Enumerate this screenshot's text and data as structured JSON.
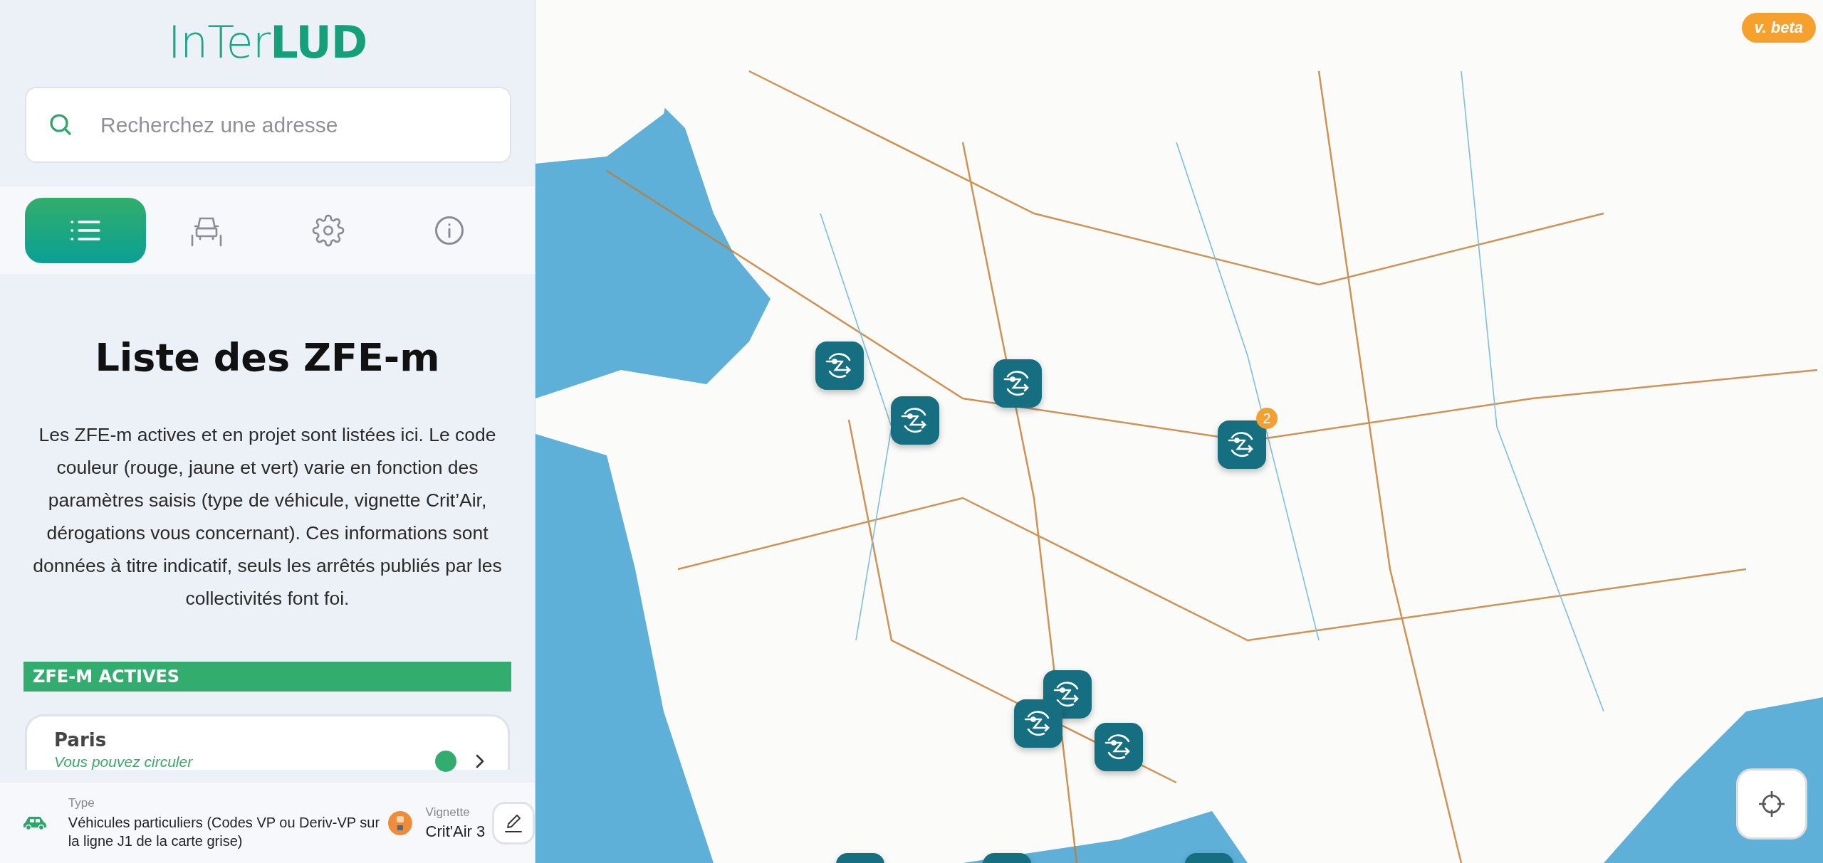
{
  "logo": "InTer**LUD**",
  "search": {
    "placeholder": "Recherchez une adresse"
  },
  "tabs": [
    {
      "kind": "list",
      "selected": true
    },
    {
      "kind": "vehicle",
      "selected": false
    },
    {
      "kind": "settings",
      "selected": false
    },
    {
      "kind": "info",
      "selected": false
    }
  ],
  "title": "Liste des ZFE-m",
  "description": "Les ZFE-m actives et en projet sont listées ici. Le code couleur (rouge, jaune et vert) varie en fonction des paramètres saisis (type de véhicule, vignette Crit’Air, dérogations vous concernant). Ces informations sont données à titre indicatif, seuls les arrêtés publiés par les collectivités font foi.",
  "section": "ZFE-M ACTIVES",
  "zones": [
    {
      "name": "Paris",
      "status": "Vous pouvez circuler",
      "color": "#33ad6e"
    }
  ],
  "vehicle": {
    "type_label": "Type",
    "type": "Véhicules particuliers (Codes VP ou Deriv-VP sur la ligne J1 de la carte grise)",
    "vignette_label": "Vignette",
    "vignette": "Crit'Air 3"
  },
  "map": {
    "version_badge": "v. beta",
    "markers": [
      {
        "kind": "single"
      },
      {
        "kind": "single"
      },
      {
        "kind": "single"
      },
      {
        "kind": "group",
        "badge": "2"
      },
      {
        "kind": "single"
      },
      {
        "kind": "single"
      },
      {
        "kind": "single"
      },
      {
        "kind": "single"
      },
      {
        "kind": "single"
      },
      {
        "kind": "single"
      }
    ]
  }
}
